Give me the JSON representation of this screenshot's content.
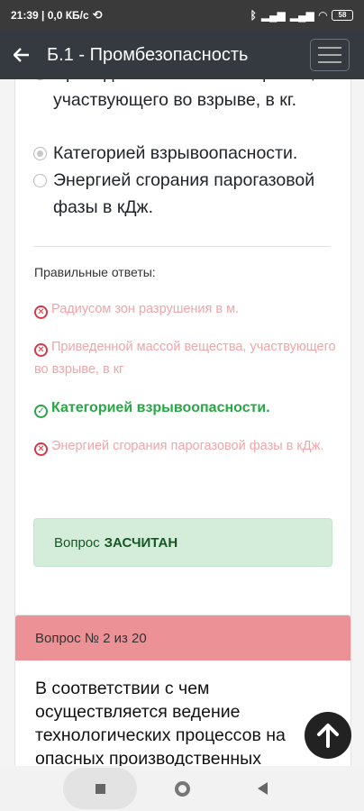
{
  "status": {
    "time_speed": "21:39 | 0,0 КБ/с",
    "battery": "58"
  },
  "appbar": {
    "title": "Б.1 - Промбезопасность"
  },
  "question1": {
    "options": [
      {
        "text": "Приведенной массой вещества, участвующего во взрыве, в кг.",
        "checked": false
      },
      {
        "text": "Категорией взрывоопасности.",
        "checked": true
      },
      {
        "text": "Энергией сгорания парогазовой фазы в кДж.",
        "checked": false
      }
    ],
    "answers_label": "Правильные ответы:",
    "answers": [
      {
        "text": "Радиусом зон разрушения в м.",
        "correct": false
      },
      {
        "text": "Приведенной массой вещества, участвующего во взрыве, в кг",
        "correct": false
      },
      {
        "text": "Категорией взрывоопасности.",
        "correct": true
      },
      {
        "text": "Энергией сгорания парогазовой фазы в кДж.",
        "correct": false
      }
    ],
    "result_prefix": "Вопрос",
    "result_status": "ЗАСЧИТАН"
  },
  "question2": {
    "header": "Вопрос № 2 из 20",
    "text": "В соответствии с чем осуществляется ведение технологических процессов на опасных производственных"
  },
  "icons": {
    "back": "arrow-left-icon",
    "menu": "hamburger-menu-icon",
    "scroll_top": "arrow-up-icon",
    "wrong": "x-circle-icon",
    "right": "check-circle-icon"
  }
}
